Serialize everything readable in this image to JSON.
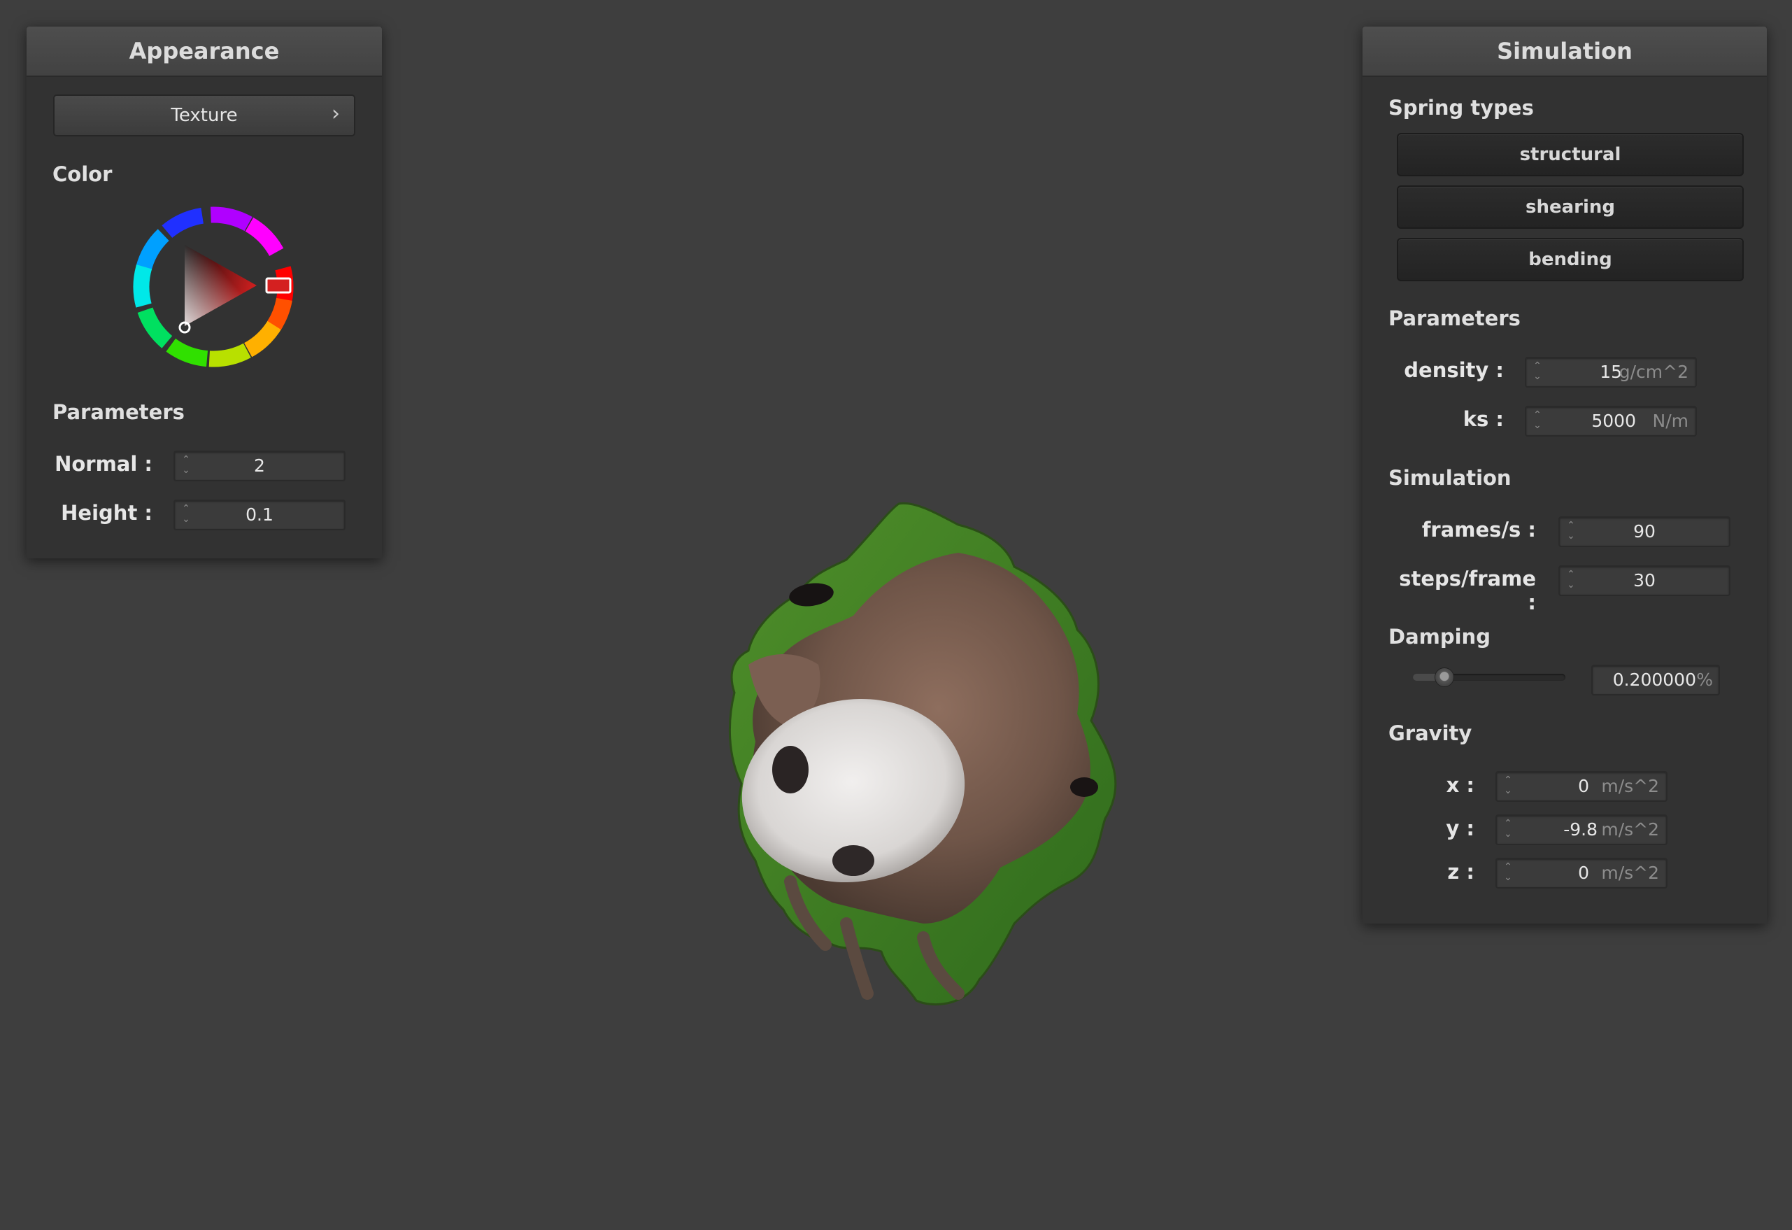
{
  "appearance": {
    "title": "Appearance",
    "texture_label": "Texture",
    "texture_chevron": "›",
    "color_label": "Color",
    "color_value": "#c81e1e",
    "parameters_label": "Parameters",
    "normal_label": "Normal :",
    "normal_value": "2",
    "height_label": "Height :",
    "height_value": "0.1"
  },
  "simulation_panel": {
    "title": "Simulation",
    "spring_types_label": "Spring types",
    "spring_types": [
      "structural",
      "shearing",
      "bending"
    ],
    "parameters_label": "Parameters",
    "density_label": "density :",
    "density_value": "15",
    "density_unit": "g/cm^2",
    "ks_label": "ks :",
    "ks_value": "5000",
    "ks_unit": "N/m",
    "simulation_label": "Simulation",
    "fps_label": "frames/s :",
    "fps_value": "90",
    "steps_label": "steps/frame :",
    "steps_value": "30",
    "damping_label": "Damping",
    "damping_value": "0.200000",
    "damping_unit": "%",
    "damping_level": 0.2,
    "gravity_label": "Gravity",
    "gx_label": "x :",
    "gx_value": "0",
    "gy_label": "y :",
    "gy_value": "-9.8",
    "gz_label": "z :",
    "gz_value": "0",
    "gravity_unit": "m/s^2"
  },
  "icons": {
    "spin_arrows": "spin-arrows-icon",
    "chevron": "chevron-right-icon"
  }
}
